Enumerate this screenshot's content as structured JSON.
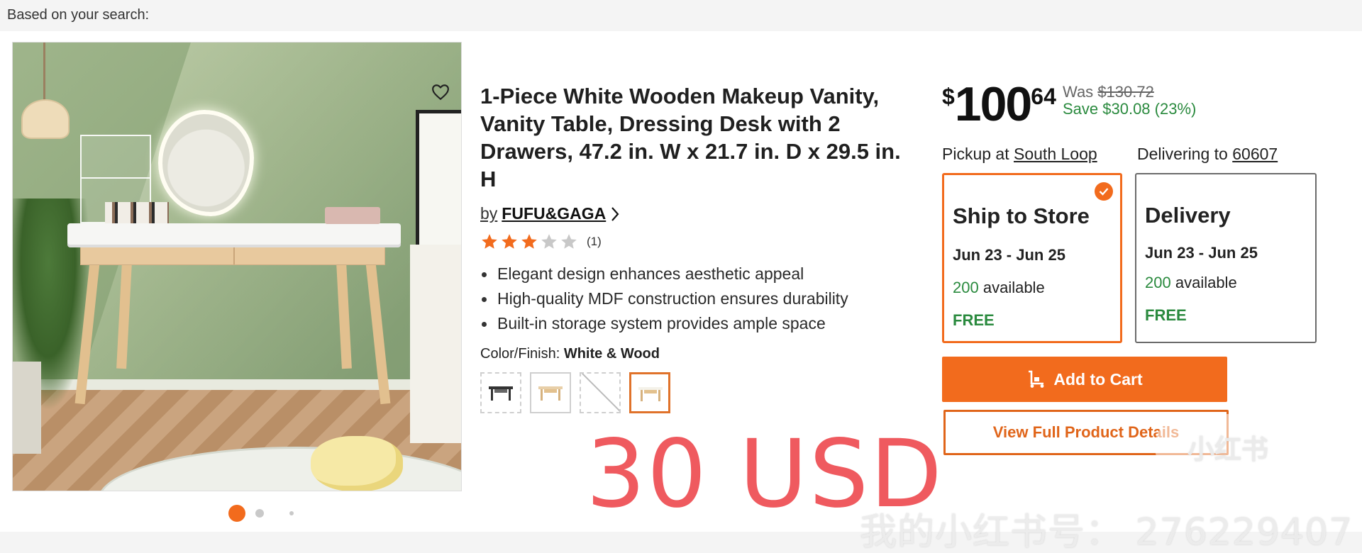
{
  "page": {
    "header_label": "Based on your search:"
  },
  "gallery": {
    "favorite_icon": "heart-icon",
    "dots": [
      {
        "active": true
      },
      {
        "active": false
      },
      {
        "active": false
      }
    ]
  },
  "product": {
    "title": "1-Piece White Wooden Makeup Vanity, Vanity Table, Dressing Desk with 2 Drawers, 47.2 in. W x 21.7 in. D x 29.5 in. H",
    "by_label": "by",
    "brand": "FUFU&GAGA",
    "rating": {
      "stars": 3,
      "max": 5,
      "count_label": "(1)"
    },
    "bullets": [
      "Elegant design enhances aesthetic appeal",
      "High-quality MDF construction ensures durability",
      "Built-in storage system provides ample space"
    ],
    "color_label": "Color/Finish:",
    "color_value": "White & Wood",
    "swatch_count": 4,
    "selected_swatch": 4
  },
  "overlay": {
    "price_note": "30 USD",
    "watermark_logo": "小红书",
    "watermark_text": "我的小红书号： 276229407"
  },
  "pricing": {
    "currency": "$",
    "dollars": "100",
    "cents": "64",
    "was_label": "Was",
    "was_price": "$130.72",
    "save_text": "Save $30.08 (23%)"
  },
  "fulfillment": {
    "pickup_label": "Pickup at",
    "pickup_store": "South Loop",
    "delivering_label": "Delivering to",
    "delivering_zip": "60607",
    "ship": {
      "title": "Ship to Store",
      "dates": "Jun 23 - Jun 25",
      "count": "200",
      "avail_label": "available",
      "price": "FREE",
      "selected": true
    },
    "delivery": {
      "title": "Delivery",
      "dates": "Jun 23 - Jun 25",
      "count": "200",
      "avail_label": "available",
      "price": "FREE",
      "selected": false
    }
  },
  "actions": {
    "add_to_cart": "Add to Cart",
    "view_details": "View Full Product Details"
  },
  "colors": {
    "accent": "#f26b1d",
    "green": "#2a8a3e",
    "star": "#f26b1d",
    "star_empty": "#c8c8c8",
    "watermark_red": "#ef5a5f"
  }
}
